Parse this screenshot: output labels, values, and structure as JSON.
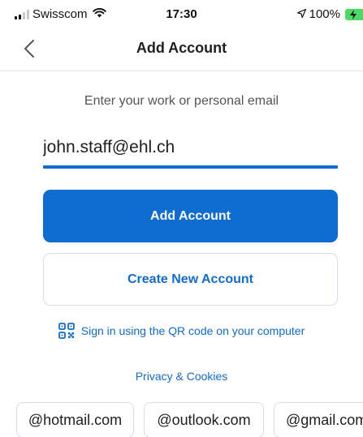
{
  "status_bar": {
    "carrier": "Swisscom",
    "time": "17:30",
    "battery": "100%",
    "icons": [
      "signal-icon",
      "wifi-icon",
      "location-arrow-icon",
      "battery-charging-icon"
    ]
  },
  "nav": {
    "title": "Add Account",
    "back_icon": "chevron-left-icon"
  },
  "form": {
    "prompt": "Enter your work or personal email",
    "email_value": "john.staff@ehl.ch",
    "add_account_label": "Add Account",
    "create_account_label": "Create New Account"
  },
  "qr": {
    "icon": "qr-code-icon",
    "label": "Sign in using the QR code on your computer"
  },
  "privacy_label": "Privacy & Cookies",
  "domain_chips": [
    "@hotmail.com",
    "@outlook.com",
    "@gmail.com"
  ],
  "colors": {
    "accent": "#0f6cd1",
    "battery": "#4cd964"
  }
}
